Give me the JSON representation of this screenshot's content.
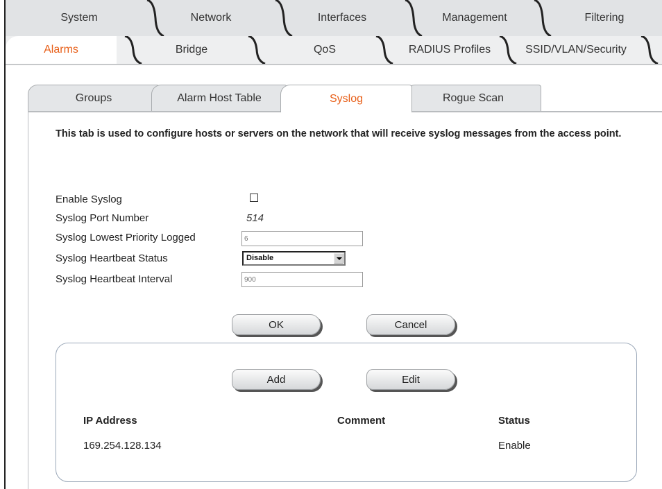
{
  "top_tabs": {
    "row1": [
      "System",
      "Network",
      "Interfaces",
      "Management",
      "Filtering"
    ],
    "row2": [
      "Alarms",
      "Bridge",
      "QoS",
      "RADIUS Profiles",
      "SSID/VLAN/Security"
    ],
    "active_row2": "Alarms"
  },
  "sub_tabs": {
    "items": [
      "Groups",
      "Alarm Host Table",
      "Syslog",
      "Rogue Scan"
    ],
    "active": "Syslog"
  },
  "description": "This tab is used to configure hosts or servers on the network that will receive syslog messages from the access point.",
  "form": {
    "enable_label": "Enable Syslog",
    "enable_checked": false,
    "port_label": "Syslog Port Number",
    "port_value": "514",
    "priority_label": "Syslog Lowest Priority Logged",
    "priority_value": "6",
    "heartbeat_status_label": "Syslog Heartbeat Status",
    "heartbeat_status_value": "Disable",
    "heartbeat_interval_label": "Syslog Heartbeat Interval",
    "heartbeat_interval_value": "900"
  },
  "buttons": {
    "ok": "OK",
    "cancel": "Cancel",
    "add": "Add",
    "edit": "Edit"
  },
  "table": {
    "headers": [
      "IP Address",
      "Comment",
      "Status"
    ],
    "rows": [
      [
        "169.254.128.134",
        "",
        "Enable"
      ]
    ]
  },
  "colors": {
    "active_tab_text": "#e8601a",
    "tab_bar": "#e1e3e5",
    "panel_border": "#9aa7b8"
  }
}
